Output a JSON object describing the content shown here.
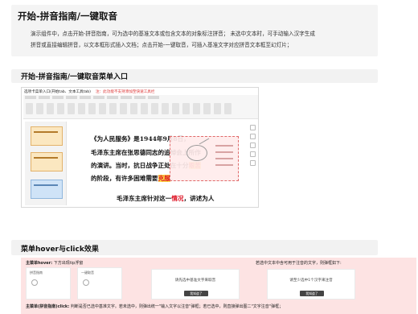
{
  "section1": {
    "title": "开始-拼音指南/一键取音",
    "desc_line1": "演示组件中，点击开始-拼音指南，可为选中的基准文本或包含文本的对象标注拼音；  未选中文本时，可手动输入汉字生成",
    "desc_line2": "拼音或直接编辑拼音，以文本框形式插入文档；点击开始-一键取音，可插入基准文字对应拼音文本框至幻灯片；"
  },
  "section2": {
    "title": "开始-拼音指南/一键取音菜单入口",
    "caption": "选项卡菜单入口(开始tab、文本工具tab)",
    "caption_note": "注：此功能不支持添加至快速工具栏",
    "slide_lines": [
      "《为人民服务》是1944年9月8日，",
      "毛泽东主席在张思德同志的追悼会上所作",
      "的演讲。当时，抗日战争正处在十分",
      "的阶段，有许多困难需要",
      "毛泽东主席针对这一",
      "，讲述为人"
    ],
    "highlight_1": "艰苦",
    "highlight_2": "克服",
    "highlight_3": "情况",
    "end_mark": "。"
  },
  "section3": {
    "title": "菜单hover与click效果",
    "hover_label": "主菜单hover:",
    "hover_text": "下方出现tip浮窗",
    "right_text": "若选中文本中含可用于注音的文字，则弹框如下:",
    "click_label": "主菜单(拼音指南)click:",
    "click_text": "判断是否已选中基准文字。若未选中，则弹出统一\"输入文字以注音\"弹框；若已选中，则直接弹出图二\"文字注音\"弹框；",
    "card_left_title": "拼音指南",
    "card_right_title": "一键取音",
    "dialog1_msg": "请先选中基准文字来取音",
    "dialog2_msg": "请至少选中1个汉字来注音",
    "ok_label": "我知道了"
  }
}
